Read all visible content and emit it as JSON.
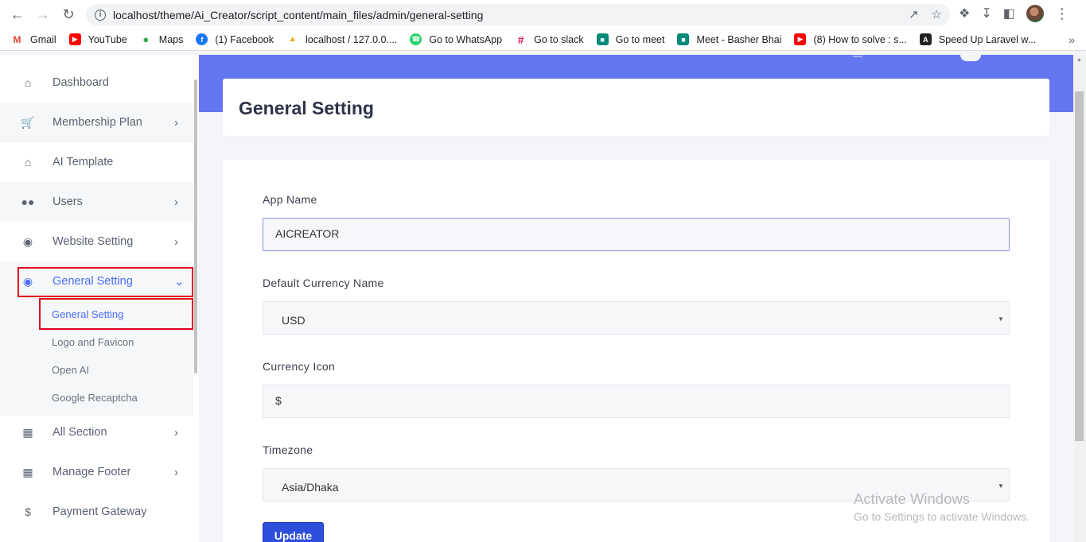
{
  "browser": {
    "url": "localhost/theme/Ai_Creator/script_content/main_files/admin/general-setting",
    "bookmarks": [
      {
        "label": "Gmail",
        "icon": "gmail-icon",
        "color": "#ea4335"
      },
      {
        "label": "YouTube",
        "icon": "youtube-icon",
        "color": "#ff0000"
      },
      {
        "label": "Maps",
        "icon": "maps-icon",
        "color": "#34a853"
      },
      {
        "label": "(1) Facebook",
        "icon": "facebook-icon",
        "color": "#1877f2"
      },
      {
        "label": "localhost / 127.0.0....",
        "icon": "phpmyadmin-icon",
        "color": "#f0a30a"
      },
      {
        "label": "Go to WhatsApp",
        "icon": "whatsapp-icon",
        "color": "#25d366"
      },
      {
        "label": "Go to slack",
        "icon": "slack-icon",
        "color": "#e01e5a"
      },
      {
        "label": "Go to meet",
        "icon": "meet-icon",
        "color": "#00897b"
      },
      {
        "label": "Meet - Basher Bhai",
        "icon": "meet-icon",
        "color": "#00897b"
      },
      {
        "label": "(8) How to solve : s...",
        "icon": "youtube-icon",
        "color": "#ff0000"
      },
      {
        "label": "Speed Up Laravel w...",
        "icon": "laravel-icon",
        "color": "#222222"
      }
    ]
  },
  "sidebar": {
    "items": [
      {
        "label": "Dashboard",
        "icon": "home-icon"
      },
      {
        "label": "Membership Plan",
        "icon": "cart-icon"
      },
      {
        "label": "AI Template",
        "icon": "home-icon"
      },
      {
        "label": "Users",
        "icon": "users-icon"
      },
      {
        "label": "Website Setting",
        "icon": "globe-icon"
      },
      {
        "label": "General Setting",
        "icon": "globe-icon"
      },
      {
        "label": "All Section",
        "icon": "grid-icon"
      },
      {
        "label": "Manage Footer",
        "icon": "grid-icon"
      },
      {
        "label": "Payment Gateway",
        "icon": "dollar-icon"
      }
    ],
    "submenu": [
      {
        "label": "General Setting"
      },
      {
        "label": "Logo and Favicon"
      },
      {
        "label": "Open AI"
      },
      {
        "label": "Google Recaptcha"
      }
    ]
  },
  "page": {
    "title": "General Setting"
  },
  "form": {
    "app_name_label": "App Name",
    "app_name_value": "AICREATOR",
    "currency_name_label": "Default Currency Name",
    "currency_name_value": "USD",
    "currency_icon_label": "Currency Icon",
    "currency_icon_value": "$",
    "timezone_label": "Timezone",
    "timezone_value": "Asia/Dhaka",
    "update_label": "Update"
  },
  "watermark": {
    "line1": "Activate Windows",
    "line2": "Go to Settings to activate Windows."
  },
  "colors": {
    "accent": "#4a6cf7",
    "hero": "#6577f0",
    "button": "#2d4fdb",
    "highlight": "#e0001b"
  }
}
